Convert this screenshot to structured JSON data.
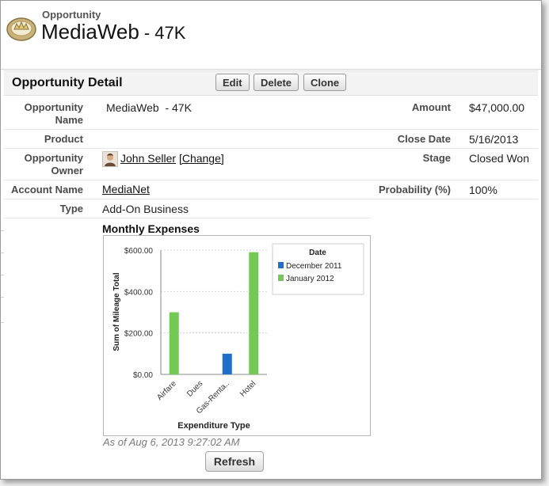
{
  "header": {
    "object_type": "Opportunity",
    "record_name": "MediaWeb",
    "record_suffix": "- 47K"
  },
  "detail": {
    "title": "Opportunity Detail",
    "buttons": {
      "edit": "Edit",
      "delete": "Delete",
      "clone": "Clone"
    }
  },
  "fields": {
    "opportunity_name_label": "Opportunity Name",
    "opportunity_name_value": "MediaWeb  - 47K",
    "product_label": "Product",
    "owner_label": "Opportunity Owner",
    "owner_name": "John Seller",
    "owner_change": "[Change]",
    "account_label": "Account Name",
    "account_value": "MediaNet",
    "type_label": "Type",
    "type_value": "Add-On Business",
    "amount_label": "Amount",
    "amount_value": "$47,000.00",
    "close_date_label": "Close Date",
    "close_date_value": "5/16/2013",
    "stage_label": "Stage",
    "stage_value": "Closed Won",
    "probability_label": "Probability (%)",
    "probability_value": "100%"
  },
  "chart_section": {
    "title": "Monthly Expenses",
    "as_of": "As of Aug 6, 2013 9:27:02 AM",
    "refresh_label": "Refresh"
  },
  "chart_data": {
    "type": "bar",
    "title": "",
    "xlabel": "Expenditure Type",
    "ylabel": "Sum of Mileage Total",
    "categories": [
      "Airfare",
      "Dues",
      "Gas-Renta..",
      "Hotel"
    ],
    "ylim": [
      0,
      600
    ],
    "yticks": [
      "$0.00",
      "$200.00",
      "$400.00",
      "$600.00"
    ],
    "legend_title": "Date",
    "legend_position": "top-right",
    "grid": true,
    "series": [
      {
        "name": "December 2011",
        "color": "#1f6fc8",
        "values": [
          0,
          0,
          100,
          0
        ]
      },
      {
        "name": "January 2012",
        "color": "#74c955",
        "values": [
          300,
          0,
          0,
          590
        ]
      }
    ]
  }
}
